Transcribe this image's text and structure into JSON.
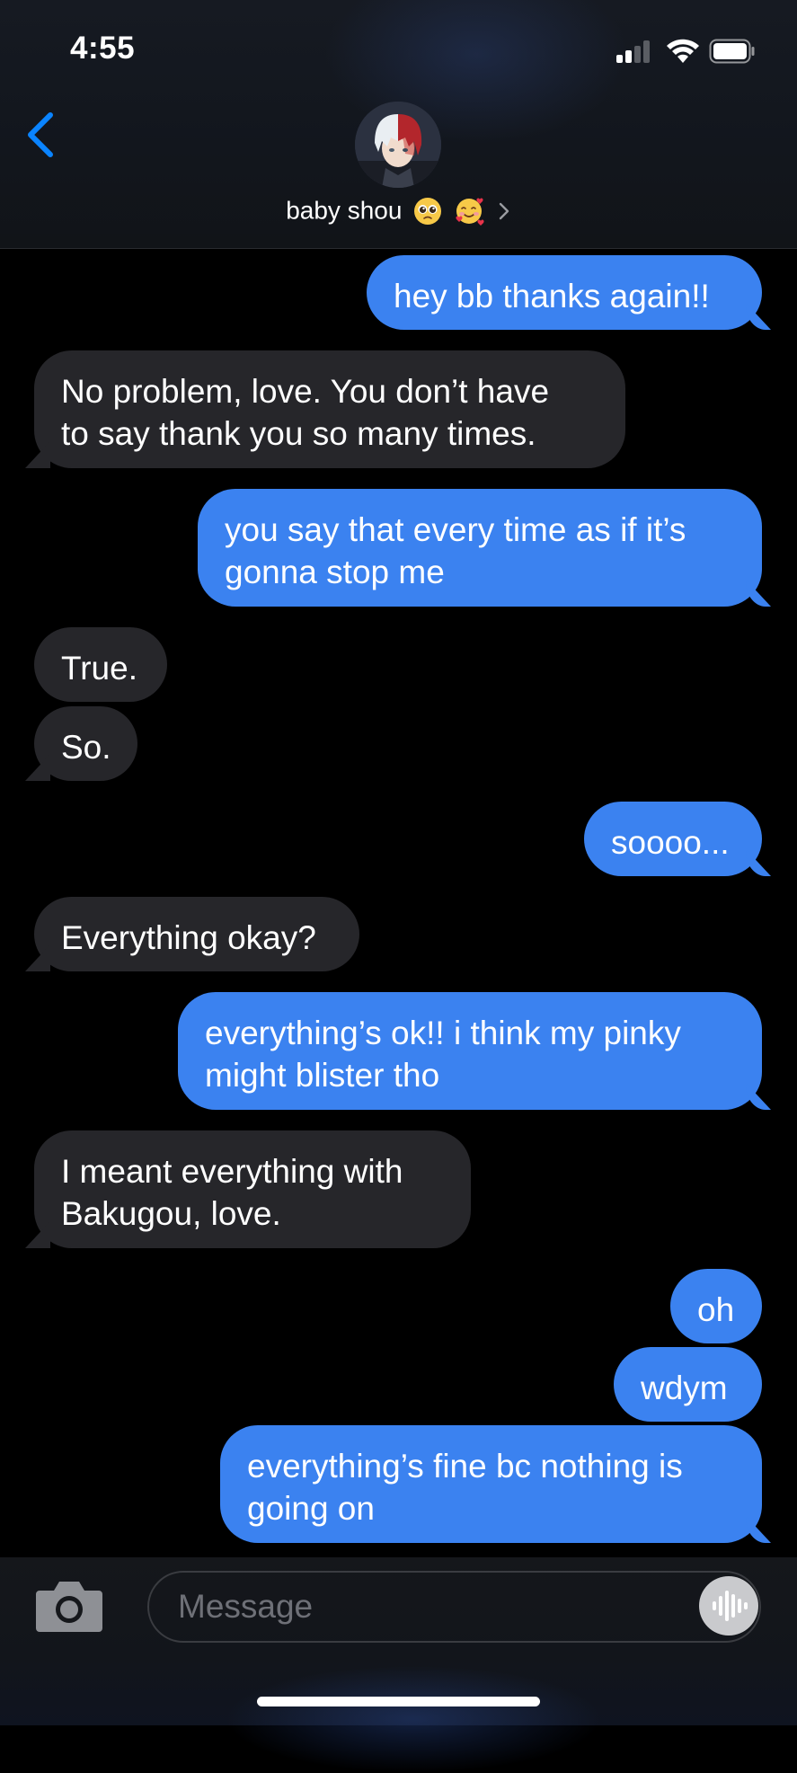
{
  "status_bar": {
    "time": "4:55"
  },
  "header": {
    "contact_name": "baby shou",
    "contact_emojis": [
      "pleading-face-emoji",
      "smiling-face-with-hearts-emoji"
    ]
  },
  "messages": [
    {
      "from": "me",
      "text": "hey bb thanks again!!"
    },
    {
      "from": "them",
      "text": "No problem, love. You don’t have\nto say thank you so many times."
    },
    {
      "from": "me",
      "text": "you say that every time as if it’s\ngonna stop me"
    },
    {
      "from": "them",
      "text": "True."
    },
    {
      "from": "them",
      "text": "So."
    },
    {
      "from": "me",
      "text": "soooo..."
    },
    {
      "from": "them",
      "text": "Everything okay?"
    },
    {
      "from": "me",
      "text": "everything’s ok!! i think my pinky\nmight blister tho"
    },
    {
      "from": "them",
      "text": "I meant everything with\nBakugou, love."
    },
    {
      "from": "me",
      "text": "oh"
    },
    {
      "from": "me",
      "text": "wdym"
    },
    {
      "from": "me",
      "text": "everything’s fine bc nothing is\ngoing on"
    }
  ],
  "composer": {
    "placeholder": "Message"
  },
  "colors": {
    "outgoing_bubble": "#3b82f0",
    "incoming_bubble": "#26262a",
    "accent": "#0a84ff"
  }
}
